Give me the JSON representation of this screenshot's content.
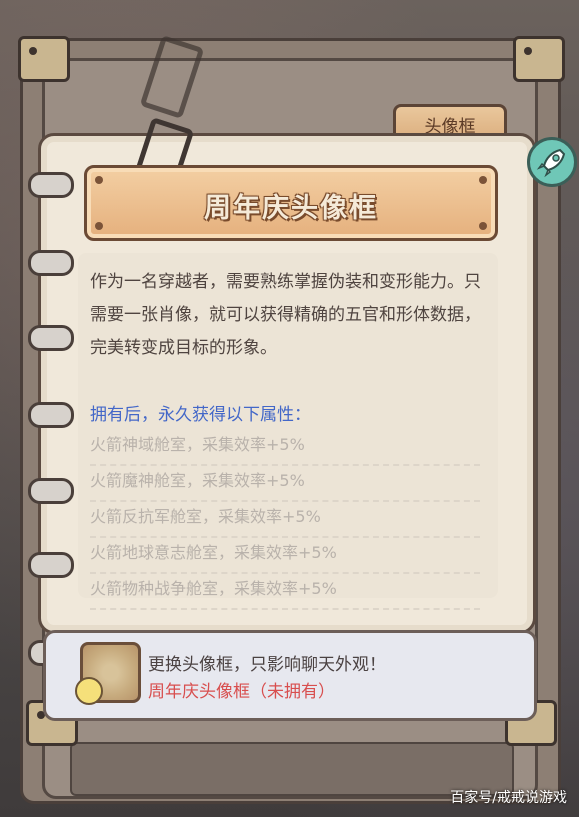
{
  "tab": {
    "label": "头像框"
  },
  "title": "周年庆头像框",
  "description": "作为一名穿越者，需要熟练掌握伪装和变形能力。只需要一张肖像，就可以获得精确的五官和形体数据，完美转变成目标的形象。",
  "attributes": {
    "heading": "拥有后，永久获得以下属性：",
    "items": [
      "火箭神域舱室，采集效率+5%",
      "火箭魔神舱室，采集效率+5%",
      "火箭反抗军舱室，采集效率+5%",
      "火箭地球意志舱室，采集效率+5%",
      "火箭物种战争舱室，采集效率+5%"
    ]
  },
  "info": {
    "line1": "更换头像框，只影响聊天外观！",
    "line2": "周年庆头像框（未拥有）"
  },
  "watermark": "百家号/戒戒说游戏",
  "colors": {
    "accent_blue": "#4367c8",
    "status_red": "#d84e4e",
    "rocket_button": "#6fc7b7"
  },
  "icons": {
    "rocket": "rocket-icon",
    "frame_preview": "avatar-frame-icon",
    "bulb": "lightbulb-icon"
  }
}
